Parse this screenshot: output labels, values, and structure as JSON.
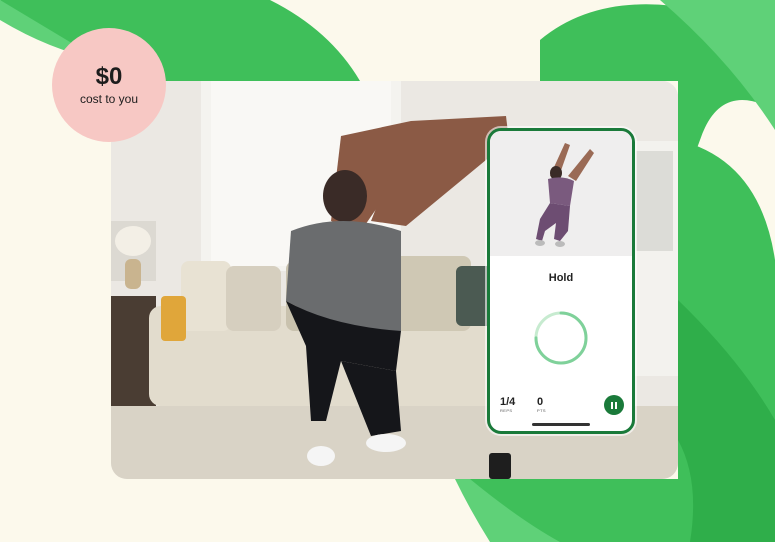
{
  "badge": {
    "amount": "$0",
    "caption": "cost to you"
  },
  "phone": {
    "title": "Hold",
    "reps_value": "1/4",
    "reps_label": "REPS",
    "pts_value": "0",
    "pts_label": "PTS",
    "progress": 0.75
  },
  "colors": {
    "accent": "#1a7a3a",
    "ribbon": "#3fbf5a",
    "badge": "#f7c8c4",
    "background": "#fcf9ec"
  },
  "icons": [
    "pause-icon"
  ]
}
